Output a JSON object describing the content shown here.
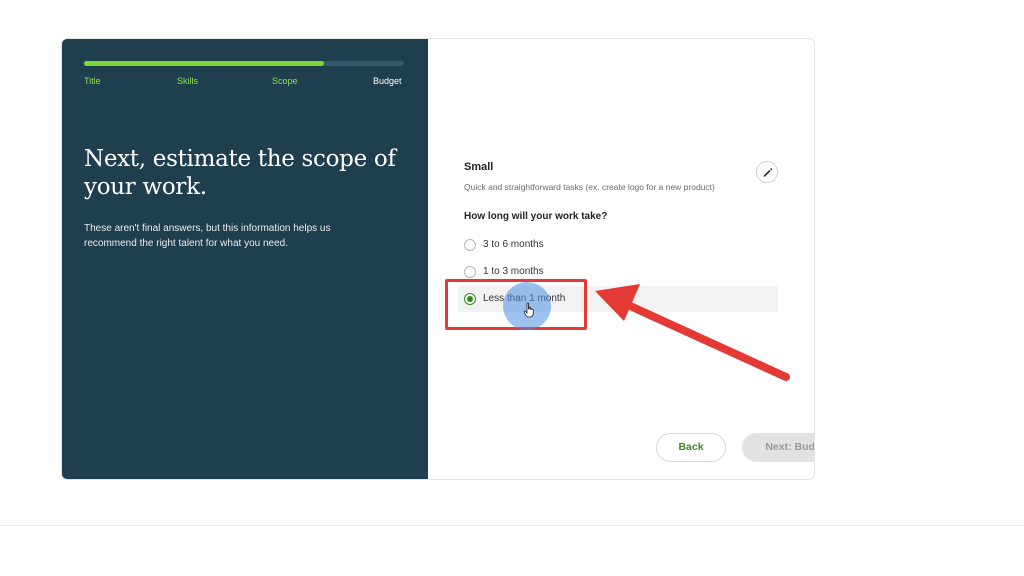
{
  "progress": {
    "percent": 75,
    "fill_color": "#7dda3a"
  },
  "steps": [
    {
      "label": "Title",
      "state": "done"
    },
    {
      "label": "Skills",
      "state": "done"
    },
    {
      "label": "Scope",
      "state": "done"
    },
    {
      "label": "Budget",
      "state": "current"
    }
  ],
  "intro": {
    "headline": "Next, estimate the scope of your work.",
    "subtext": "These aren't final answers, but this information helps us recommend the right talent for what you need."
  },
  "scope": {
    "title": "Small",
    "description": "Quick and straightforward tasks (ex. create logo for a new product)",
    "edit_icon": "pencil-icon"
  },
  "duration": {
    "question": "How long will your work take?",
    "options": [
      {
        "label": "3 to 6 months",
        "selected": false
      },
      {
        "label": "1 to 3 months",
        "selected": false
      },
      {
        "label": "Less than 1 month",
        "selected": true
      }
    ]
  },
  "buttons": {
    "back": "Back",
    "next": "Next: Budget"
  },
  "annotation": {
    "color": "#e53935",
    "click_color": "#4a90e2"
  },
  "colors": {
    "panel": "#1f3e4e",
    "accent": "#7dda3a",
    "radio_checked": "#2f8a1a"
  }
}
